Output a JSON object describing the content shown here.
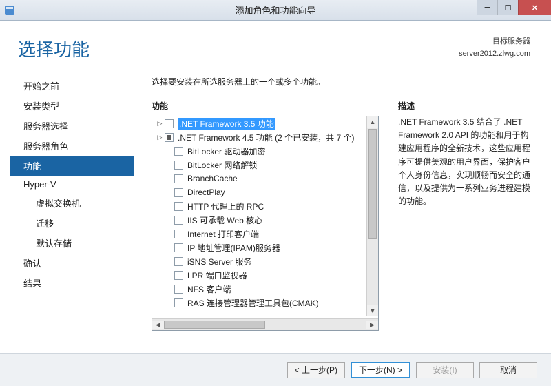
{
  "window": {
    "title": "添加角色和功能向导"
  },
  "heading": "选择功能",
  "target": {
    "label": "目标服务器",
    "server": "server2012.zlwg.com"
  },
  "nav": [
    {
      "label": "开始之前",
      "active": false,
      "indent": false
    },
    {
      "label": "安装类型",
      "active": false,
      "indent": false
    },
    {
      "label": "服务器选择",
      "active": false,
      "indent": false
    },
    {
      "label": "服务器角色",
      "active": false,
      "indent": false
    },
    {
      "label": "功能",
      "active": true,
      "indent": false
    },
    {
      "label": "Hyper-V",
      "active": false,
      "indent": false
    },
    {
      "label": "虚拟交换机",
      "active": false,
      "indent": true
    },
    {
      "label": "迁移",
      "active": false,
      "indent": true
    },
    {
      "label": "默认存储",
      "active": false,
      "indent": true
    },
    {
      "label": "确认",
      "active": false,
      "indent": false
    },
    {
      "label": "结果",
      "active": false,
      "indent": false
    }
  ],
  "instruction": "选择要安装在所选服务器上的一个或多个功能。",
  "labels": {
    "features": "功能",
    "description": "描述"
  },
  "features": [
    {
      "label": ".NET Framework 3.5 功能",
      "expandable": true,
      "checked": false,
      "selected": true
    },
    {
      "label": ".NET Framework 4.5 功能 (2 个已安装，共 7 个)",
      "expandable": true,
      "checked": "partial",
      "selected": false
    },
    {
      "label": "BitLocker 驱动器加密",
      "expandable": false,
      "checked": false,
      "selected": false
    },
    {
      "label": "BitLocker 网络解锁",
      "expandable": false,
      "checked": false,
      "selected": false
    },
    {
      "label": "BranchCache",
      "expandable": false,
      "checked": false,
      "selected": false
    },
    {
      "label": "DirectPlay",
      "expandable": false,
      "checked": false,
      "selected": false
    },
    {
      "label": "HTTP 代理上的 RPC",
      "expandable": false,
      "checked": false,
      "selected": false
    },
    {
      "label": "IIS 可承载 Web 核心",
      "expandable": false,
      "checked": false,
      "selected": false
    },
    {
      "label": "Internet 打印客户端",
      "expandable": false,
      "checked": false,
      "selected": false
    },
    {
      "label": "IP 地址管理(IPAM)服务器",
      "expandable": false,
      "checked": false,
      "selected": false
    },
    {
      "label": "iSNS Server 服务",
      "expandable": false,
      "checked": false,
      "selected": false
    },
    {
      "label": "LPR 端口监视器",
      "expandable": false,
      "checked": false,
      "selected": false
    },
    {
      "label": "NFS 客户端",
      "expandable": false,
      "checked": false,
      "selected": false
    },
    {
      "label": "RAS 连接管理器管理工具包(CMAK)",
      "expandable": false,
      "checked": false,
      "selected": false
    }
  ],
  "description": ".NET Framework 3.5 结合了 .NET Framework 2.0 API 的功能和用于构建应用程序的全新技术，这些应用程序可提供美观的用户界面，保护客户个人身份信息，实现顺畅而安全的通信，以及提供为一系列业务进程建模的功能。",
  "buttons": {
    "prev": "< 上一步(P)",
    "next": "下一步(N) >",
    "install": "安装(I)",
    "cancel": "取消"
  }
}
